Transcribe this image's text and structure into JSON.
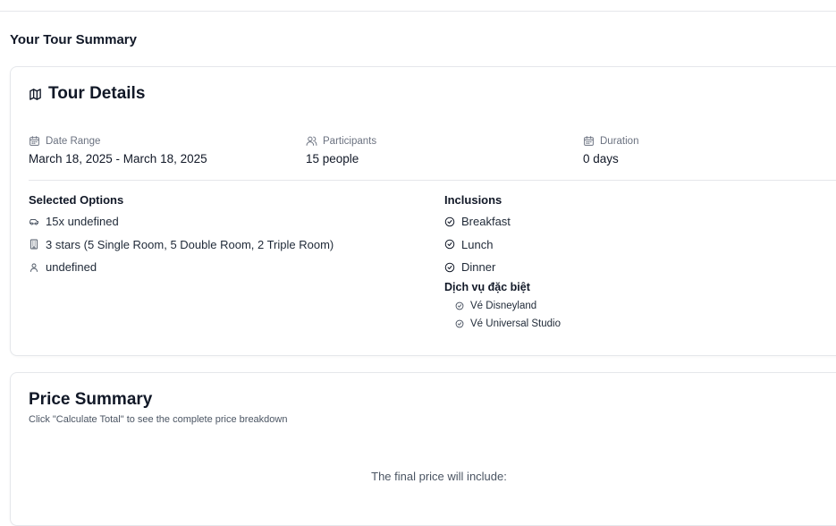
{
  "page": {
    "title": "Your Tour Summary"
  },
  "tour_details": {
    "heading": "Tour Details",
    "heading_icon": "map-icon",
    "date_range": {
      "label": "Date Range",
      "value": "March 18, 2025 - March 18, 2025",
      "icon": "calendar-icon"
    },
    "participants": {
      "label": "Participants",
      "value": "15 people",
      "icon": "users-icon"
    },
    "duration": {
      "label": "Duration",
      "value": "0 days",
      "icon": "calendar-icon"
    },
    "selected_options": {
      "title": "Selected Options",
      "items": [
        {
          "icon": "car-icon",
          "text": "15x undefined"
        },
        {
          "icon": "building-icon",
          "text": "3 stars (5 Single Room, 5 Double Room, 2 Triple Room)"
        },
        {
          "icon": "user-icon",
          "text": "undefined"
        }
      ]
    },
    "inclusions": {
      "title": "Inclusions",
      "items": [
        {
          "icon": "check-circle-icon",
          "text": "Breakfast"
        },
        {
          "icon": "check-circle-icon",
          "text": "Lunch"
        },
        {
          "icon": "check-circle-icon",
          "text": "Dinner"
        }
      ],
      "special_title": "Dịch vụ đặc biệt",
      "special_items": [
        {
          "icon": "check-circle-icon",
          "text": "Vé Disneyland"
        },
        {
          "icon": "check-circle-icon",
          "text": "Vé Universal Studio"
        }
      ]
    }
  },
  "price_summary": {
    "heading": "Price Summary",
    "subtitle": "Click \"Calculate Total\" to see the complete price breakdown",
    "note": "The final price will include:"
  }
}
